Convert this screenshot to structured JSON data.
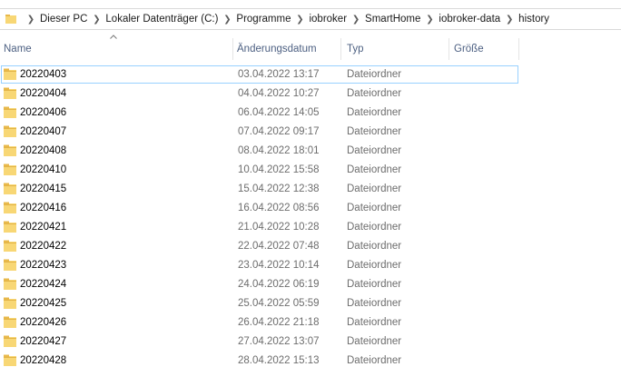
{
  "breadcrumb": {
    "items": [
      "Dieser PC",
      "Lokaler Datenträger (C:)",
      "Programme",
      "iobroker",
      "SmartHome",
      "iobroker-data",
      "history"
    ]
  },
  "columns": {
    "name": "Name",
    "date": "Änderungsdatum",
    "type": "Typ",
    "size": "Größe"
  },
  "colors": {
    "folder_fill": "#f8d775",
    "folder_tab": "#e8b84a",
    "selection_border": "#99d1ff",
    "header_text": "#4d6082"
  },
  "rows": [
    {
      "name": "20220403",
      "date": "03.04.2022 13:17",
      "type": "Dateiordner",
      "selected": true
    },
    {
      "name": "20220404",
      "date": "04.04.2022 10:27",
      "type": "Dateiordner"
    },
    {
      "name": "20220406",
      "date": "06.04.2022 14:05",
      "type": "Dateiordner"
    },
    {
      "name": "20220407",
      "date": "07.04.2022 09:17",
      "type": "Dateiordner"
    },
    {
      "name": "20220408",
      "date": "08.04.2022 18:01",
      "type": "Dateiordner"
    },
    {
      "name": "20220410",
      "date": "10.04.2022 15:58",
      "type": "Dateiordner"
    },
    {
      "name": "20220415",
      "date": "15.04.2022 12:38",
      "type": "Dateiordner"
    },
    {
      "name": "20220416",
      "date": "16.04.2022 08:56",
      "type": "Dateiordner"
    },
    {
      "name": "20220421",
      "date": "21.04.2022 10:28",
      "type": "Dateiordner"
    },
    {
      "name": "20220422",
      "date": "22.04.2022 07:48",
      "type": "Dateiordner"
    },
    {
      "name": "20220423",
      "date": "23.04.2022 10:14",
      "type": "Dateiordner"
    },
    {
      "name": "20220424",
      "date": "24.04.2022 06:19",
      "type": "Dateiordner"
    },
    {
      "name": "20220425",
      "date": "25.04.2022 05:59",
      "type": "Dateiordner"
    },
    {
      "name": "20220426",
      "date": "26.04.2022 21:18",
      "type": "Dateiordner"
    },
    {
      "name": "20220427",
      "date": "27.04.2022 13:07",
      "type": "Dateiordner"
    },
    {
      "name": "20220428",
      "date": "28.04.2022 15:13",
      "type": "Dateiordner"
    }
  ]
}
